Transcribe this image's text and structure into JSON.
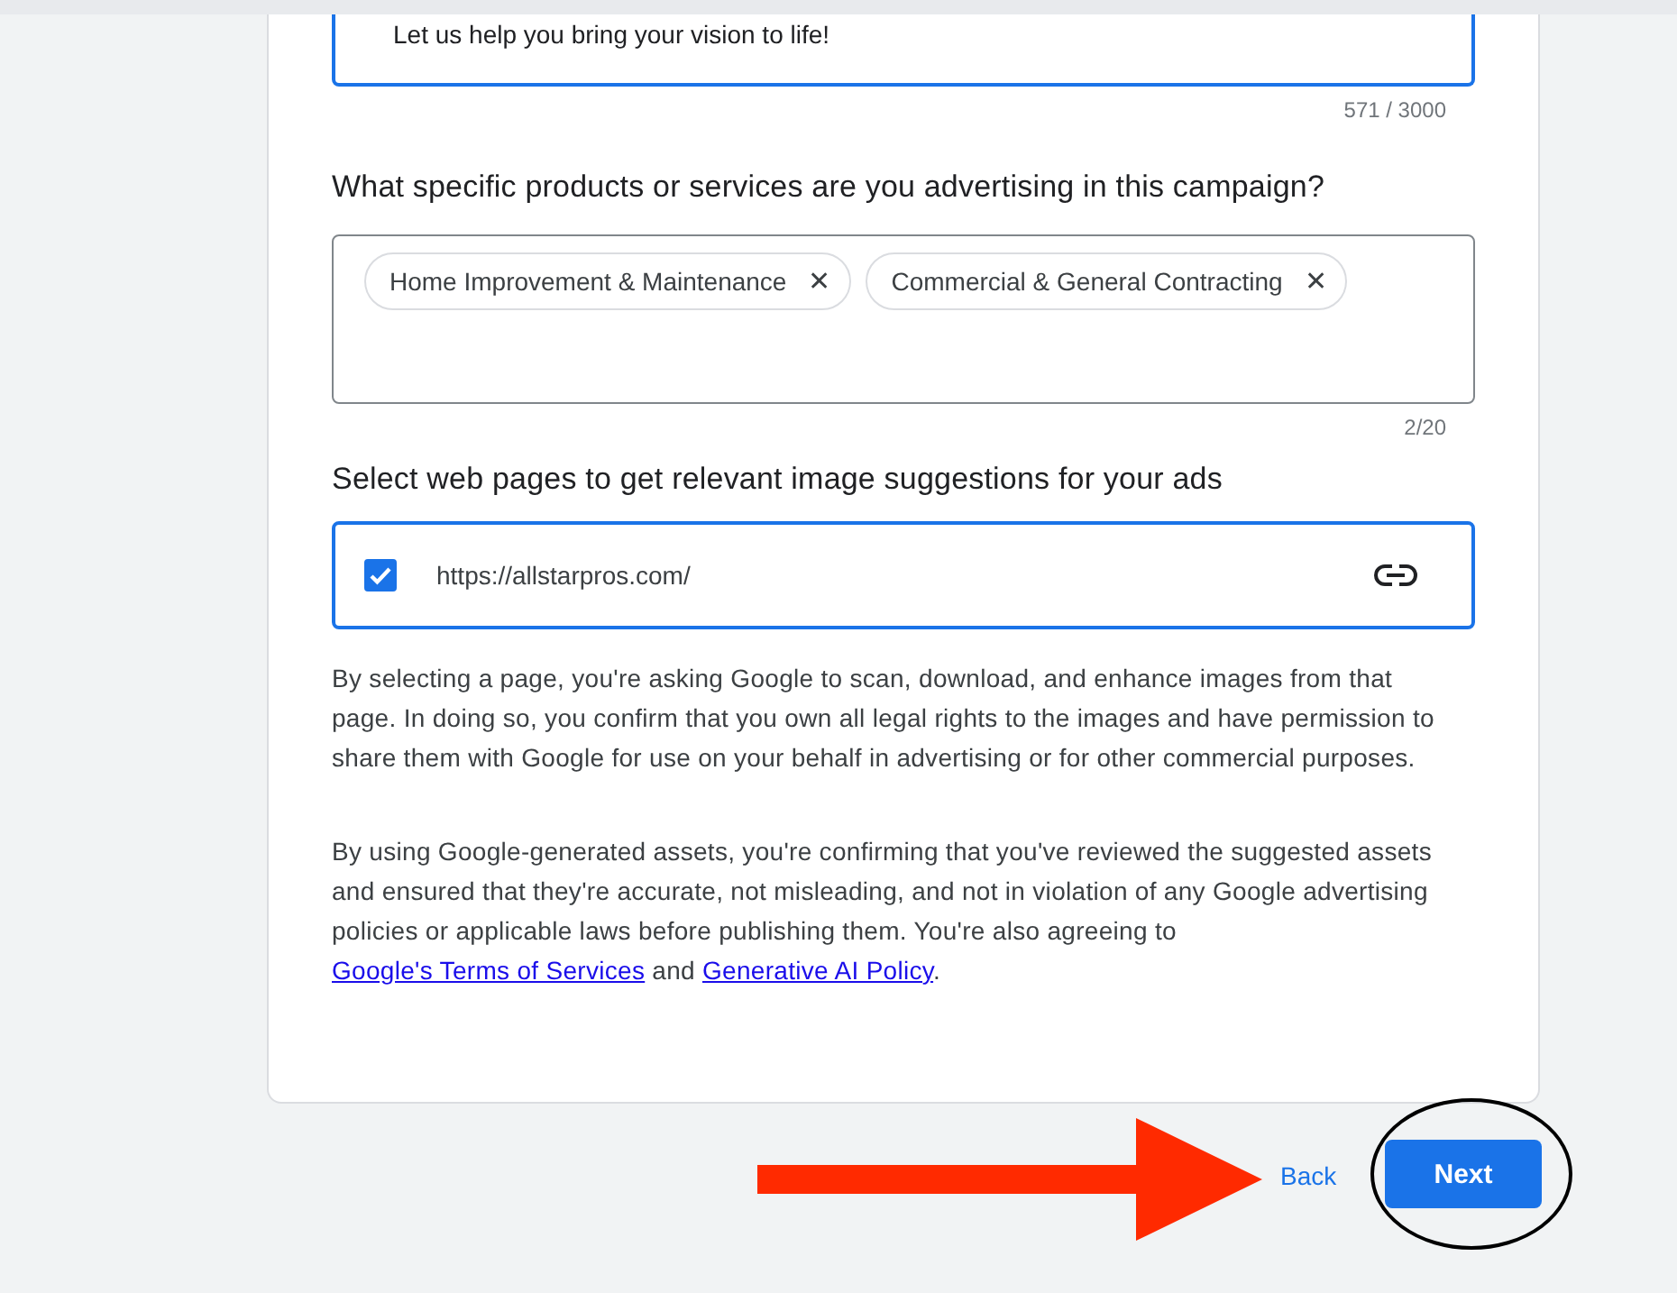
{
  "description_field": {
    "visible_text": "Let us help you bring your vision to life!",
    "counter": "571 / 3000"
  },
  "products": {
    "question": "What specific products or services are you advertising in this campaign?",
    "chips": [
      {
        "label": "Home Improvement & Maintenance",
        "remove_icon": "✕"
      },
      {
        "label": "Commercial & General Contracting",
        "remove_icon": "✕"
      }
    ],
    "counter": "2/20"
  },
  "web_pages": {
    "heading": "Select web pages to get relevant image suggestions for your ads",
    "items": [
      {
        "url": "https://allstarpros.com/",
        "checked": true
      }
    ]
  },
  "disclaimer": "By selecting a page, you're asking Google to scan, download, and enhance images from that page. In doing so, you confirm that you own all legal rights to the images and have permission to share them with Google for use on your behalf in advertising or for other commercial purposes.",
  "consent": {
    "text": "By using Google-generated assets, you're confirming that you've reviewed the suggested assets and ensured that they're accurate, not misleading, and not in violation of any Google advertising policies or applicable laws before publishing them. You're also agreeing to",
    "links": [
      "Google's Terms of Services",
      "Generative AI Policy"
    ],
    "joiner": "and",
    "end": "."
  },
  "footer": {
    "back": "Back",
    "next": "Next"
  }
}
